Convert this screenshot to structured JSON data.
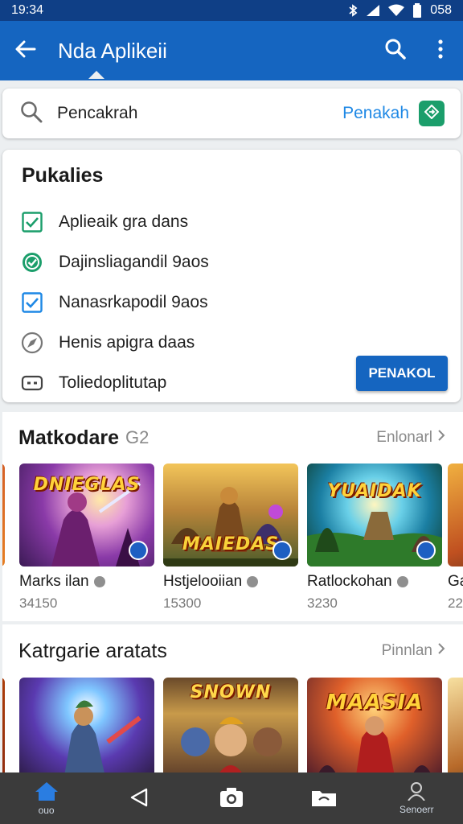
{
  "status_bar": {
    "time": "19:34",
    "battery": "058"
  },
  "app_bar": {
    "title": "Nda Aplikeii"
  },
  "search": {
    "placeholder": "Pencakrah",
    "action_label": "Penakah"
  },
  "filters": {
    "title": "Pukalies",
    "items": [
      {
        "label": "Aplieaik gra dans",
        "icon": "checkbox-checked-icon"
      },
      {
        "label": "Dajinsliagandil 9aos",
        "icon": "check-circle-icon"
      },
      {
        "label": "Nanasrkapodil 9aos",
        "icon": "checkbox-blue-icon"
      },
      {
        "label": "Henis apigra daas",
        "icon": "compass-icon"
      },
      {
        "label": "Toliedoplitutap",
        "icon": "controller-icon"
      }
    ],
    "apply_label": "PENAKOL"
  },
  "popular": {
    "title": "Matkodare",
    "count": "G2",
    "more_label": "Enlonarl",
    "cards": [
      {
        "name": "Marks ilan",
        "price": "34150",
        "art": "DNIEGLAS"
      },
      {
        "name": "Hstjelooiian",
        "price": "15300",
        "art": "MAIEDAS"
      },
      {
        "name": "Ratlockohan",
        "price": "3230",
        "art": "YUAIDAK"
      },
      {
        "name": "Ga",
        "price": "22"
      }
    ]
  },
  "category": {
    "title": "Katrgarie aratats",
    "more_label": "Pinnlan",
    "cards": [
      {
        "art": ""
      },
      {
        "art": "SNOWN"
      },
      {
        "art": "MAASIA"
      },
      {
        "art": ""
      }
    ]
  },
  "bottom_nav": {
    "items": [
      {
        "icon": "home-icon",
        "label": "ouo"
      },
      {
        "icon": "back-triangle-icon",
        "label": ""
      },
      {
        "icon": "camera-icon",
        "label": ""
      },
      {
        "icon": "folder-icon",
        "label": ""
      },
      {
        "icon": "profile-icon",
        "label": "Senoerr"
      }
    ]
  },
  "colors": {
    "primary": "#1565c0",
    "status_bar": "#0f3f86",
    "accent_green": "#1b9e6b",
    "link": "#1e88e5"
  }
}
